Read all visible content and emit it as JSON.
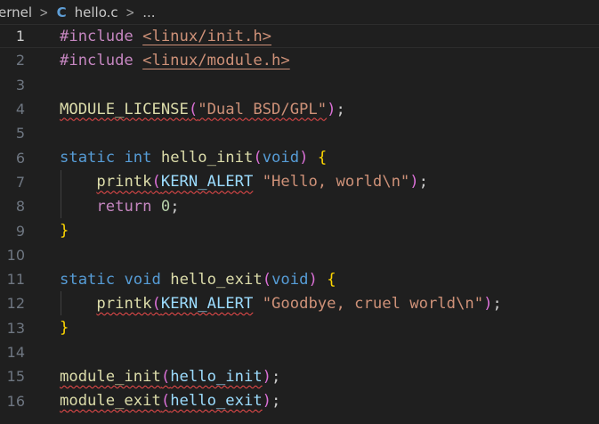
{
  "breadcrumb": {
    "folder": "ernel",
    "file_icon": "C",
    "file": "hello.c",
    "more": "..."
  },
  "editor": {
    "current_line": 1,
    "lines": [
      {
        "n": "1",
        "tokens": [
          [
            "pp",
            "#include "
          ],
          [
            "str-link",
            "<linux/init.h>"
          ]
        ]
      },
      {
        "n": "2",
        "tokens": [
          [
            "pp",
            "#include "
          ],
          [
            "str-link",
            "<linux/module.h>"
          ]
        ]
      },
      {
        "n": "3",
        "tokens": []
      },
      {
        "n": "4",
        "tokens": [
          [
            "fn-sq",
            "MODULE_LICENSE"
          ],
          [
            "br2-sq",
            "("
          ],
          [
            "str-sq",
            "\"Dual BSD/GPL\""
          ],
          [
            "br2",
            ")"
          ],
          [
            "punc",
            ";"
          ]
        ]
      },
      {
        "n": "5",
        "tokens": []
      },
      {
        "n": "6",
        "tokens": [
          [
            "kw",
            "static"
          ],
          [
            "punc",
            " "
          ],
          [
            "kw",
            "int"
          ],
          [
            "punc",
            " "
          ],
          [
            "fn",
            "hello_init"
          ],
          [
            "br2",
            "("
          ],
          [
            "kw",
            "void"
          ],
          [
            "br2",
            ")"
          ],
          [
            "punc",
            " "
          ],
          [
            "br1",
            "{"
          ]
        ]
      },
      {
        "n": "7",
        "tokens": [
          [
            "punc",
            "    "
          ],
          [
            "fn-sq",
            "printk"
          ],
          [
            "br2-sq",
            "("
          ],
          [
            "var-sq",
            "KERN_ALERT"
          ],
          [
            "punc",
            " "
          ],
          [
            "str",
            "\"Hello, world\\n\""
          ],
          [
            "br2",
            ")"
          ],
          [
            "punc",
            ";"
          ]
        ]
      },
      {
        "n": "8",
        "tokens": [
          [
            "punc",
            "    "
          ],
          [
            "ctrl",
            "return"
          ],
          [
            "punc",
            " "
          ],
          [
            "num",
            "0"
          ],
          [
            "punc",
            ";"
          ]
        ]
      },
      {
        "n": "9",
        "tokens": [
          [
            "br1",
            "}"
          ]
        ]
      },
      {
        "n": "10",
        "tokens": []
      },
      {
        "n": "11",
        "tokens": [
          [
            "kw",
            "static"
          ],
          [
            "punc",
            " "
          ],
          [
            "kw",
            "void"
          ],
          [
            "punc",
            " "
          ],
          [
            "fn",
            "hello_exit"
          ],
          [
            "br2",
            "("
          ],
          [
            "kw",
            "void"
          ],
          [
            "br2",
            ")"
          ],
          [
            "punc",
            " "
          ],
          [
            "br1",
            "{"
          ]
        ]
      },
      {
        "n": "12",
        "tokens": [
          [
            "punc",
            "    "
          ],
          [
            "fn-sq",
            "printk"
          ],
          [
            "br2-sq",
            "("
          ],
          [
            "var-sq",
            "KERN_ALERT"
          ],
          [
            "punc",
            " "
          ],
          [
            "str",
            "\"Goodbye, cruel world\\n\""
          ],
          [
            "br2",
            ")"
          ],
          [
            "punc",
            ";"
          ]
        ]
      },
      {
        "n": "13",
        "tokens": [
          [
            "br1",
            "}"
          ]
        ]
      },
      {
        "n": "14",
        "tokens": []
      },
      {
        "n": "15",
        "tokens": [
          [
            "fn-sq",
            "module_init"
          ],
          [
            "br2-sq",
            "("
          ],
          [
            "var-sq",
            "hello_init"
          ],
          [
            "br2",
            ")"
          ],
          [
            "punc",
            ";"
          ]
        ]
      },
      {
        "n": "16",
        "tokens": [
          [
            "fn-sq",
            "module_exit"
          ],
          [
            "br2-sq",
            "("
          ],
          [
            "var-sq",
            "hello_exit"
          ],
          [
            "br2",
            ")"
          ],
          [
            "punc",
            ";"
          ]
        ]
      }
    ]
  },
  "colors": {
    "background": "#1f1f1f",
    "preprocessor": "#c586c0",
    "string": "#ce9178",
    "function": "#dcdcaa",
    "keyword": "#569cd6",
    "variable": "#9cdcfe",
    "number": "#b5cea8",
    "bracket_level1": "#ffd700",
    "bracket_level2": "#da70d6",
    "error_squiggle": "#f14c4c"
  }
}
